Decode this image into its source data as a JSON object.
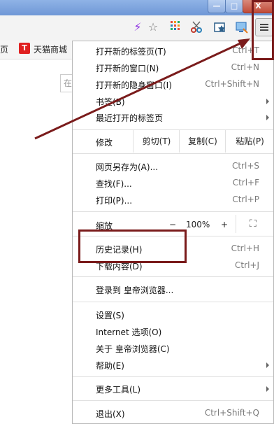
{
  "window": {
    "minimize": "—",
    "maximize": "□",
    "close": "X"
  },
  "toolbar": {
    "icons": [
      "lightning-icon",
      "star-icon",
      "apps-icon",
      "scissors-icon",
      "favorites-icon",
      "screenshot-icon",
      "menu-icon"
    ]
  },
  "bookmarks": {
    "left_text": "页",
    "tmall_badge": "T",
    "tmall_label": "天猫商城"
  },
  "page": {
    "search_fragment": "在"
  },
  "menu": {
    "items": [
      {
        "label": "打开新的标签页(T)",
        "shortcut": "Ctrl+T"
      },
      {
        "label": "打开新的窗口(N)",
        "shortcut": "Ctrl+N"
      },
      {
        "label": "打开新的隐身窗口(I)",
        "shortcut": "Ctrl+Shift+N"
      },
      {
        "label": "书签(B)",
        "shortcut": ""
      },
      {
        "label": "最近打开的标签页",
        "shortcut": ""
      }
    ],
    "edit": {
      "label": "修改",
      "cut": "剪切(T)",
      "copy": "复制(C)",
      "paste": "粘贴(P)"
    },
    "page_items": [
      {
        "label": "网页另存为(A)...",
        "shortcut": "Ctrl+S"
      },
      {
        "label": "查找(F)...",
        "shortcut": "Ctrl+F"
      },
      {
        "label": "打印(P)...",
        "shortcut": "Ctrl+P"
      }
    ],
    "zoom": {
      "label": "缩放",
      "minus": "−",
      "value": "100%",
      "plus": "+",
      "fullscreen": "⛶"
    },
    "history": {
      "label": "历史记录(H)",
      "shortcut": "Ctrl+H"
    },
    "downloads": {
      "label": "下载内容(D)",
      "shortcut": "Ctrl+J"
    },
    "signin": {
      "label": "登录到 皇帝浏览器..."
    },
    "settings": {
      "label": "设置(S)"
    },
    "internet_options": {
      "label": "Internet 选项(O)"
    },
    "about": {
      "label": "关于 皇帝浏览器(C)"
    },
    "help": {
      "label": "帮助(E)"
    },
    "more_tools": {
      "label": "更多工具(L)"
    },
    "exit": {
      "label": "退出(X)",
      "shortcut": "Ctrl+Shift+Q"
    }
  },
  "annotation": {
    "color": "#7a1b1b"
  }
}
